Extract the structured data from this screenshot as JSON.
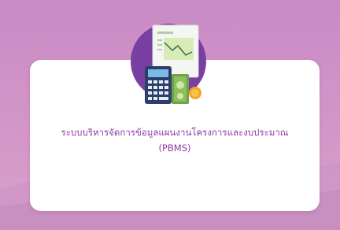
{
  "card": {
    "title_line1": "ระบบบริหารจัดการข้อมูลแผนงานโครงการและงบประมาณ",
    "title_line2": "(PBMS)"
  },
  "colors": {
    "background": "#c98ac5",
    "card": "#ffffff",
    "title_text": "#8e3aa5",
    "icon_circle": "#7a3fa3"
  },
  "icons": [
    "budget-document-icon",
    "calculator-icon",
    "money-coins-icon"
  ]
}
